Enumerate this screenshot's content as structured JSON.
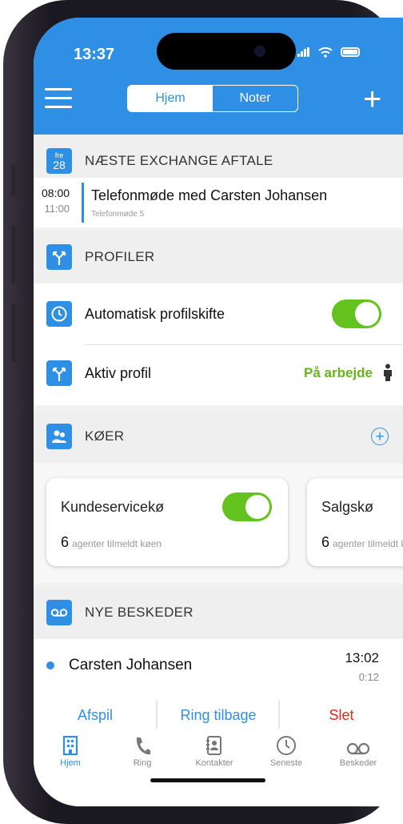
{
  "status_bar": {
    "time": "13:37"
  },
  "header": {
    "tabs": [
      "Hjem",
      "Noter"
    ]
  },
  "appointment_section": {
    "title": "NÆSTE EXCHANGE AFTALE",
    "cal_day": "fre",
    "cal_date": "28",
    "start": "08:00",
    "end": "11:00",
    "appt_title": "Telefonmøde med Carsten Johansen",
    "appt_sub": "Telefonmøde 5"
  },
  "profiles_section": {
    "title": "PROFILER",
    "auto_switch_label": "Automatisk profilskifte",
    "auto_switch_on": true,
    "active_profile_label": "Aktiv profil",
    "active_profile_value": "På arbejde"
  },
  "queues_section": {
    "title": "KØER",
    "queues": [
      {
        "name": "Kundeservicekø",
        "count": "6",
        "count_label": "agenter tilmeldt køen",
        "on": true
      },
      {
        "name": "Salgskø",
        "count": "6",
        "count_label": "agenter tilmeldt køen"
      }
    ]
  },
  "messages_section": {
    "title": "NYE BESKEDER",
    "items": [
      {
        "caller": "Carsten Johansen",
        "time": "13:02",
        "duration": "0:12"
      }
    ],
    "actions": {
      "play": "Afspil",
      "call_back": "Ring tilbage",
      "delete": "Slet"
    }
  },
  "tabbar": [
    "Hjem",
    "Ring",
    "Kontakter",
    "Seneste",
    "Beskeder"
  ],
  "colors": {
    "accent": "#2f8fe4",
    "toggle_on": "#63c21d",
    "delete": "#e8231b",
    "profile_active": "#63b51a"
  }
}
